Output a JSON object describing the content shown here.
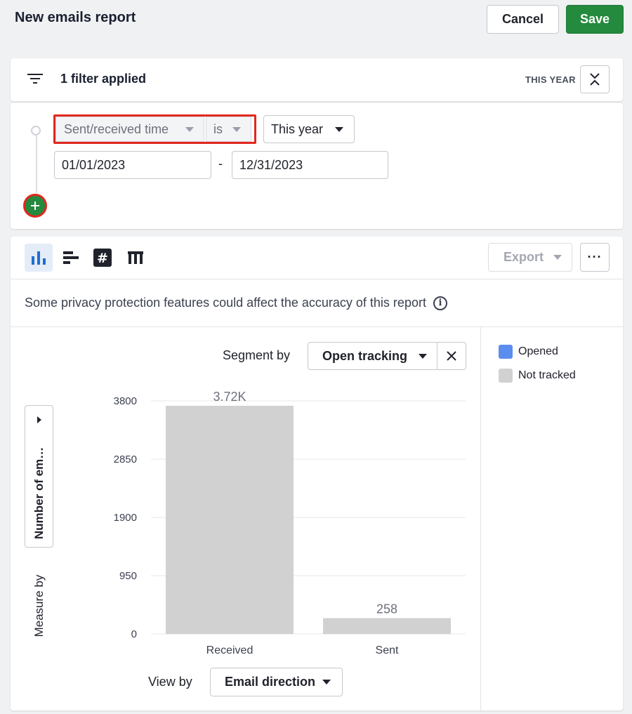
{
  "header": {
    "title": "New emails report",
    "cancel_label": "Cancel",
    "save_label": "Save"
  },
  "filter": {
    "summary": "1 filter applied",
    "period_tag": "THIS YEAR",
    "field": "Sent/received time",
    "operator": "is",
    "range": "This year",
    "date_start": "01/01/2023",
    "date_separator": "-",
    "date_end": "12/31/2023"
  },
  "toolbar": {
    "export_label": "Export",
    "more_label": "···"
  },
  "notice": {
    "text": "Some privacy protection features could affect the accuracy of this report",
    "info_glyph": "i"
  },
  "segment": {
    "label": "Segment by",
    "value": "Open tracking"
  },
  "legend": [
    {
      "label": "Opened",
      "color": "#5b8def"
    },
    {
      "label": "Not tracked",
      "color": "#d1d1d1"
    }
  ],
  "measure": {
    "label": "Measure by",
    "value": "Number of emails"
  },
  "viewby": {
    "label": "View by",
    "value": "Email direction"
  },
  "chart_data": {
    "type": "bar",
    "categories": [
      "Received",
      "Sent"
    ],
    "series": [
      {
        "name": "Not tracked",
        "values": [
          3720,
          258
        ],
        "color": "#d1d1d1"
      }
    ],
    "data_labels": [
      "3.72K",
      "258"
    ],
    "ylim": [
      0,
      3800
    ],
    "yticks": [
      0,
      950,
      1900,
      2850,
      3800
    ],
    "grid": true
  }
}
